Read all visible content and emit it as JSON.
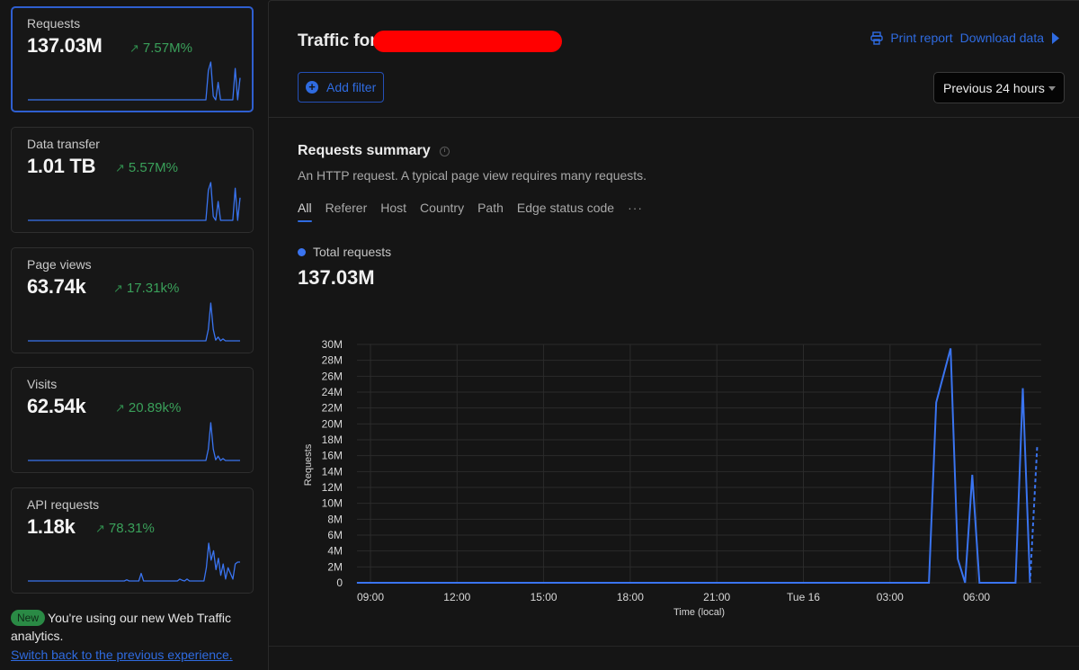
{
  "sidebar": {
    "cards": [
      {
        "label": "Requests",
        "value": "137.03M",
        "delta": "7.57M%",
        "delta_direction": "up",
        "active": true,
        "spark": [
          0,
          0,
          0,
          0,
          0,
          0,
          0,
          0,
          0,
          0,
          0,
          0,
          0,
          0,
          0,
          0,
          0,
          0,
          0,
          0,
          0,
          0,
          0,
          0,
          0,
          0,
          0,
          0,
          0,
          0,
          0,
          0,
          0,
          0,
          0,
          0,
          0,
          0,
          0,
          0,
          0,
          0,
          0,
          0,
          0,
          0,
          0,
          0,
          0,
          0,
          0,
          0,
          0,
          0,
          0,
          0,
          0,
          0,
          0,
          0,
          0,
          0,
          0,
          0,
          0,
          0,
          0,
          0,
          0,
          0,
          0,
          0,
          0,
          0,
          0.77,
          1,
          0.1,
          0,
          0.46,
          0,
          0,
          0,
          0,
          0,
          0,
          0.83,
          0,
          0.58
        ]
      },
      {
        "label": "Data transfer",
        "value": "1.01 TB",
        "delta": "5.57M%",
        "delta_direction": "up",
        "active": false,
        "spark": [
          0,
          0,
          0,
          0,
          0,
          0,
          0,
          0,
          0,
          0,
          0,
          0,
          0,
          0,
          0,
          0,
          0,
          0,
          0,
          0,
          0,
          0,
          0,
          0,
          0,
          0,
          0,
          0,
          0,
          0,
          0,
          0,
          0,
          0,
          0,
          0,
          0,
          0,
          0,
          0,
          0,
          0,
          0,
          0,
          0,
          0,
          0,
          0,
          0,
          0,
          0,
          0,
          0,
          0,
          0,
          0,
          0,
          0,
          0,
          0,
          0,
          0,
          0,
          0,
          0,
          0,
          0,
          0,
          0,
          0,
          0,
          0,
          0,
          0,
          0.8,
          1,
          0.1,
          0,
          0.5,
          0,
          0,
          0,
          0,
          0,
          0,
          0.85,
          0,
          0.6
        ]
      },
      {
        "label": "Page views",
        "value": "63.74k",
        "delta": "17.31k%",
        "delta_direction": "up",
        "active": false,
        "spark": [
          0,
          0,
          0,
          0,
          0,
          0,
          0,
          0,
          0,
          0,
          0,
          0,
          0,
          0,
          0,
          0,
          0,
          0,
          0,
          0,
          0,
          0,
          0,
          0,
          0,
          0,
          0,
          0,
          0,
          0,
          0,
          0,
          0,
          0,
          0,
          0,
          0,
          0,
          0,
          0,
          0,
          0,
          0,
          0,
          0,
          0,
          0,
          0,
          0,
          0,
          0,
          0,
          0,
          0,
          0,
          0,
          0,
          0,
          0,
          0,
          0,
          0,
          0,
          0,
          0,
          0,
          0,
          0,
          0,
          0,
          0,
          0,
          0,
          0,
          0.3,
          1,
          0.3,
          0.02,
          0.1,
          0,
          0.05,
          0,
          0,
          0,
          0,
          0,
          0,
          0
        ]
      },
      {
        "label": "Visits",
        "value": "62.54k",
        "delta": "20.89k%",
        "delta_direction": "up",
        "active": false,
        "spark": [
          0,
          0,
          0,
          0,
          0,
          0,
          0,
          0,
          0,
          0,
          0,
          0,
          0,
          0,
          0,
          0,
          0,
          0,
          0,
          0,
          0,
          0,
          0,
          0,
          0,
          0,
          0,
          0,
          0,
          0,
          0,
          0,
          0,
          0,
          0,
          0,
          0,
          0,
          0,
          0,
          0,
          0,
          0,
          0,
          0,
          0,
          0,
          0,
          0,
          0,
          0,
          0,
          0,
          0,
          0,
          0,
          0,
          0,
          0,
          0,
          0,
          0,
          0,
          0,
          0,
          0,
          0,
          0,
          0,
          0,
          0,
          0,
          0,
          0,
          0.3,
          1,
          0.3,
          0.02,
          0.12,
          0,
          0.05,
          0,
          0,
          0,
          0,
          0,
          0,
          0
        ]
      },
      {
        "label": "API requests",
        "value": "1.18k",
        "delta": "78.31%",
        "delta_direction": "up",
        "active": false,
        "spark": [
          0,
          0,
          0,
          0,
          0,
          0,
          0,
          0,
          0,
          0,
          0,
          0,
          0,
          0,
          0,
          0,
          0,
          0,
          0,
          0,
          0,
          0,
          0,
          0,
          0,
          0,
          0,
          0,
          0,
          0,
          0,
          0,
          0,
          0,
          0,
          0,
          0,
          0,
          0,
          0,
          0,
          0.03,
          0,
          0,
          0,
          0,
          0,
          0.2,
          0,
          0,
          0,
          0,
          0,
          0,
          0,
          0,
          0,
          0,
          0,
          0,
          0,
          0,
          0,
          0.05,
          0.02,
          0,
          0.05,
          0,
          0,
          0,
          0,
          0,
          0,
          0,
          0.35,
          1,
          0.55,
          0.8,
          0.3,
          0.6,
          0.15,
          0.45,
          0.05,
          0.35,
          0.2,
          0.05,
          0.45,
          0.5,
          0.5
        ]
      }
    ],
    "notice": {
      "badge": "New",
      "text": "You're using our new Web Traffic analytics.",
      "link": "Switch back to the previous experience."
    }
  },
  "header": {
    "title_prefix": "Traffic for",
    "title_redacted": true,
    "print_label": "Print report",
    "download_label": "Download data",
    "add_filter_label": "Add filter",
    "time_range": "Previous 24 hours"
  },
  "summary": {
    "title": "Requests summary",
    "description": "An HTTP request. A typical page view requires many requests.",
    "tabs": [
      {
        "label": "All",
        "active": true
      },
      {
        "label": "Referer",
        "active": false
      },
      {
        "label": "Host",
        "active": false
      },
      {
        "label": "Country",
        "active": false
      },
      {
        "label": "Path",
        "active": false
      },
      {
        "label": "Edge status code",
        "active": false
      },
      {
        "label": "···",
        "active": false
      }
    ],
    "legend_label": "Total requests",
    "total_value": "137.03M"
  },
  "colors": {
    "accent": "#2f6be0",
    "series": "#3a74f0",
    "positive": "#3aa05a",
    "redaction": "#ff0000"
  },
  "chart_data": {
    "type": "line",
    "title": "",
    "xlabel": "Time (local)",
    "ylabel": "Requests",
    "ylim": [
      0,
      30000000
    ],
    "yticks": [
      0,
      2000000,
      4000000,
      6000000,
      8000000,
      10000000,
      12000000,
      14000000,
      16000000,
      18000000,
      20000000,
      22000000,
      24000000,
      26000000,
      28000000,
      30000000
    ],
    "ytick_labels": [
      "0",
      "2M",
      "4M",
      "6M",
      "8M",
      "10M",
      "12M",
      "14M",
      "16M",
      "18M",
      "20M",
      "22M",
      "24M",
      "26M",
      "28M",
      "30M"
    ],
    "xlim_hours": [
      -0.5,
      24.2
    ],
    "xticks_hours": [
      0,
      3,
      6,
      9,
      12,
      15,
      18,
      21
    ],
    "xtick_labels": [
      "09:00",
      "12:00",
      "15:00",
      "18:00",
      "21:00",
      "Tue 16",
      "03:00",
      "06:00"
    ],
    "grid": true,
    "legend": "top-left",
    "series": [
      {
        "name": "Total requests",
        "x_hours": [
          -0.47,
          19.35,
          19.6,
          20.1,
          20.35,
          20.6,
          20.85,
          21.1,
          22.35,
          22.6,
          22.85
        ],
        "values": [
          0,
          0,
          22700000,
          29500000,
          3000000,
          0,
          13600000,
          0,
          0,
          24500000,
          0
        ],
        "style": "solid"
      },
      {
        "name": "Total requests (partial)",
        "x_hours": [
          22.85,
          23.1
        ],
        "values": [
          0,
          17200000
        ],
        "style": "dashed"
      }
    ]
  }
}
